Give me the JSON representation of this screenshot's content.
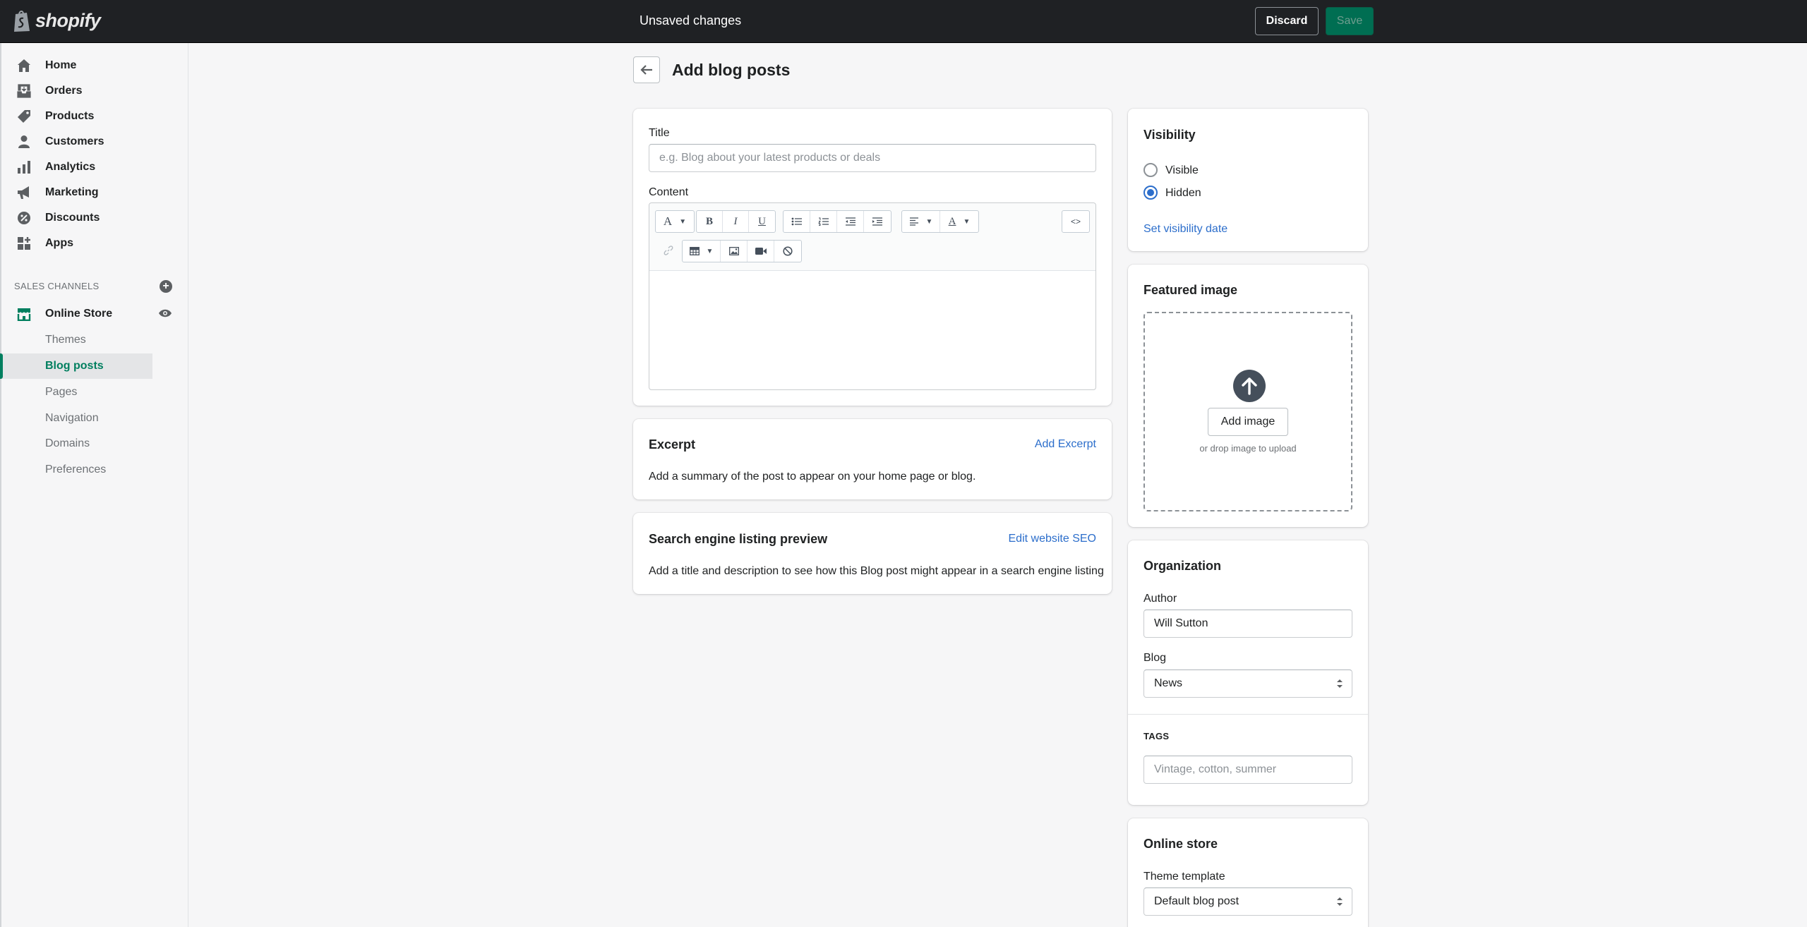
{
  "app": {
    "logo_text": "shopify",
    "top_title": "Unsaved changes",
    "discard_label": "Discard",
    "save_label": "Save"
  },
  "sidebar": {
    "main_items": [
      {
        "label": "Home",
        "icon": "home-icon"
      },
      {
        "label": "Orders",
        "icon": "orders-icon"
      },
      {
        "label": "Products",
        "icon": "tag-icon"
      },
      {
        "label": "Customers",
        "icon": "person-icon"
      },
      {
        "label": "Analytics",
        "icon": "bar-chart-icon"
      },
      {
        "label": "Marketing",
        "icon": "megaphone-icon"
      },
      {
        "label": "Discounts",
        "icon": "discount-icon"
      },
      {
        "label": "Apps",
        "icon": "apps-icon"
      }
    ],
    "sales_channels_label": "SALES CHANNELS",
    "online_store_label": "Online Store",
    "sub_items": [
      "Themes",
      "Blog posts",
      "Pages",
      "Navigation",
      "Domains",
      "Preferences"
    ],
    "active_sub_item": "Blog posts"
  },
  "page": {
    "title": "Add blog posts"
  },
  "post_card": {
    "title_label": "Title",
    "title_placeholder": "e.g. Blog about your latest products or deals",
    "content_label": "Content"
  },
  "excerpt_card": {
    "title": "Excerpt",
    "action": "Add Excerpt",
    "body": "Add a summary of the post to appear on your home page or blog."
  },
  "seo_card": {
    "title": "Search engine listing preview",
    "action": "Edit website SEO",
    "body": "Add a title and description to see how this Blog post might appear in a search engine listing"
  },
  "visibility_card": {
    "title": "Visibility",
    "option_visible": "Visible",
    "option_hidden": "Hidden",
    "selected": "Hidden",
    "set_date_link": "Set visibility date"
  },
  "featured_card": {
    "title": "Featured image",
    "add_image": "Add image",
    "drop_hint": "or drop image to upload"
  },
  "organization_card": {
    "title": "Organization",
    "author_label": "Author",
    "author_value": "Will Sutton",
    "blog_label": "Blog",
    "blog_value": "News",
    "tags_label": "TAGS",
    "tags_placeholder": "Vintage, cotton, summer"
  },
  "online_store_card": {
    "title": "Online store",
    "template_label": "Theme template",
    "template_value": "Default blog post"
  },
  "colors": {
    "accent": "#2c6ecb",
    "brand_green": "#007f5f",
    "topbar": "#1f2124"
  }
}
